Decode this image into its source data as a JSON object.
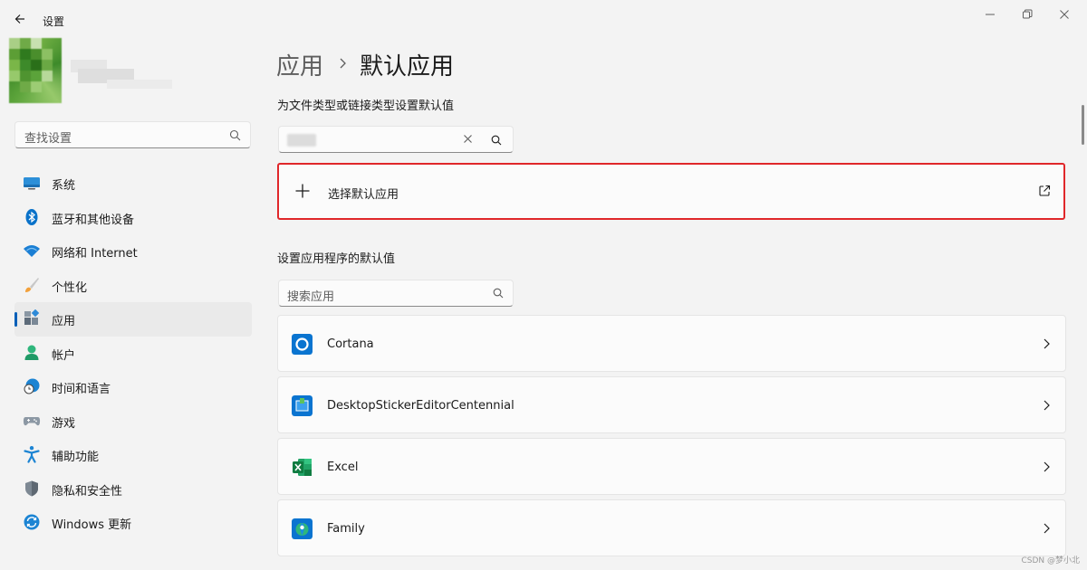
{
  "window": {
    "title": "设置"
  },
  "sidebar": {
    "search_placeholder": "查找设置",
    "items": [
      {
        "label": "系统",
        "icon": "monitor-icon"
      },
      {
        "label": "蓝牙和其他设备",
        "icon": "bluetooth-icon"
      },
      {
        "label": "网络和 Internet",
        "icon": "wifi-icon"
      },
      {
        "label": "个性化",
        "icon": "brush-icon"
      },
      {
        "label": "应用",
        "icon": "apps-icon",
        "active": true
      },
      {
        "label": "帐户",
        "icon": "person-icon"
      },
      {
        "label": "时间和语言",
        "icon": "clock-globe-icon"
      },
      {
        "label": "游戏",
        "icon": "gamepad-icon"
      },
      {
        "label": "辅助功能",
        "icon": "accessibility-icon"
      },
      {
        "label": "隐私和安全性",
        "icon": "shield-icon"
      },
      {
        "label": "Windows 更新",
        "icon": "sync-icon"
      }
    ]
  },
  "main": {
    "breadcrumb_parent": "应用",
    "breadcrumb_current": "默认应用",
    "filetype_section_title": "为文件类型或链接类型设置默认值",
    "choose_default_label": "选择默认应用",
    "apps_section_title": "设置应用程序的默认值",
    "apps_search_placeholder": "搜索应用",
    "apps": [
      {
        "name": "Cortana",
        "icon": "cortana-icon"
      },
      {
        "name": "DesktopStickerEditorCentennial",
        "icon": "sticker-editor-icon"
      },
      {
        "name": "Excel",
        "icon": "excel-icon"
      },
      {
        "name": "Family",
        "icon": "family-icon"
      }
    ]
  },
  "watermark": "CSDN @梦小北",
  "colors": {
    "accent": "#005fb8",
    "highlight_border": "#e0272a",
    "background": "#f3f3f3",
    "card": "#fbfbfb"
  }
}
